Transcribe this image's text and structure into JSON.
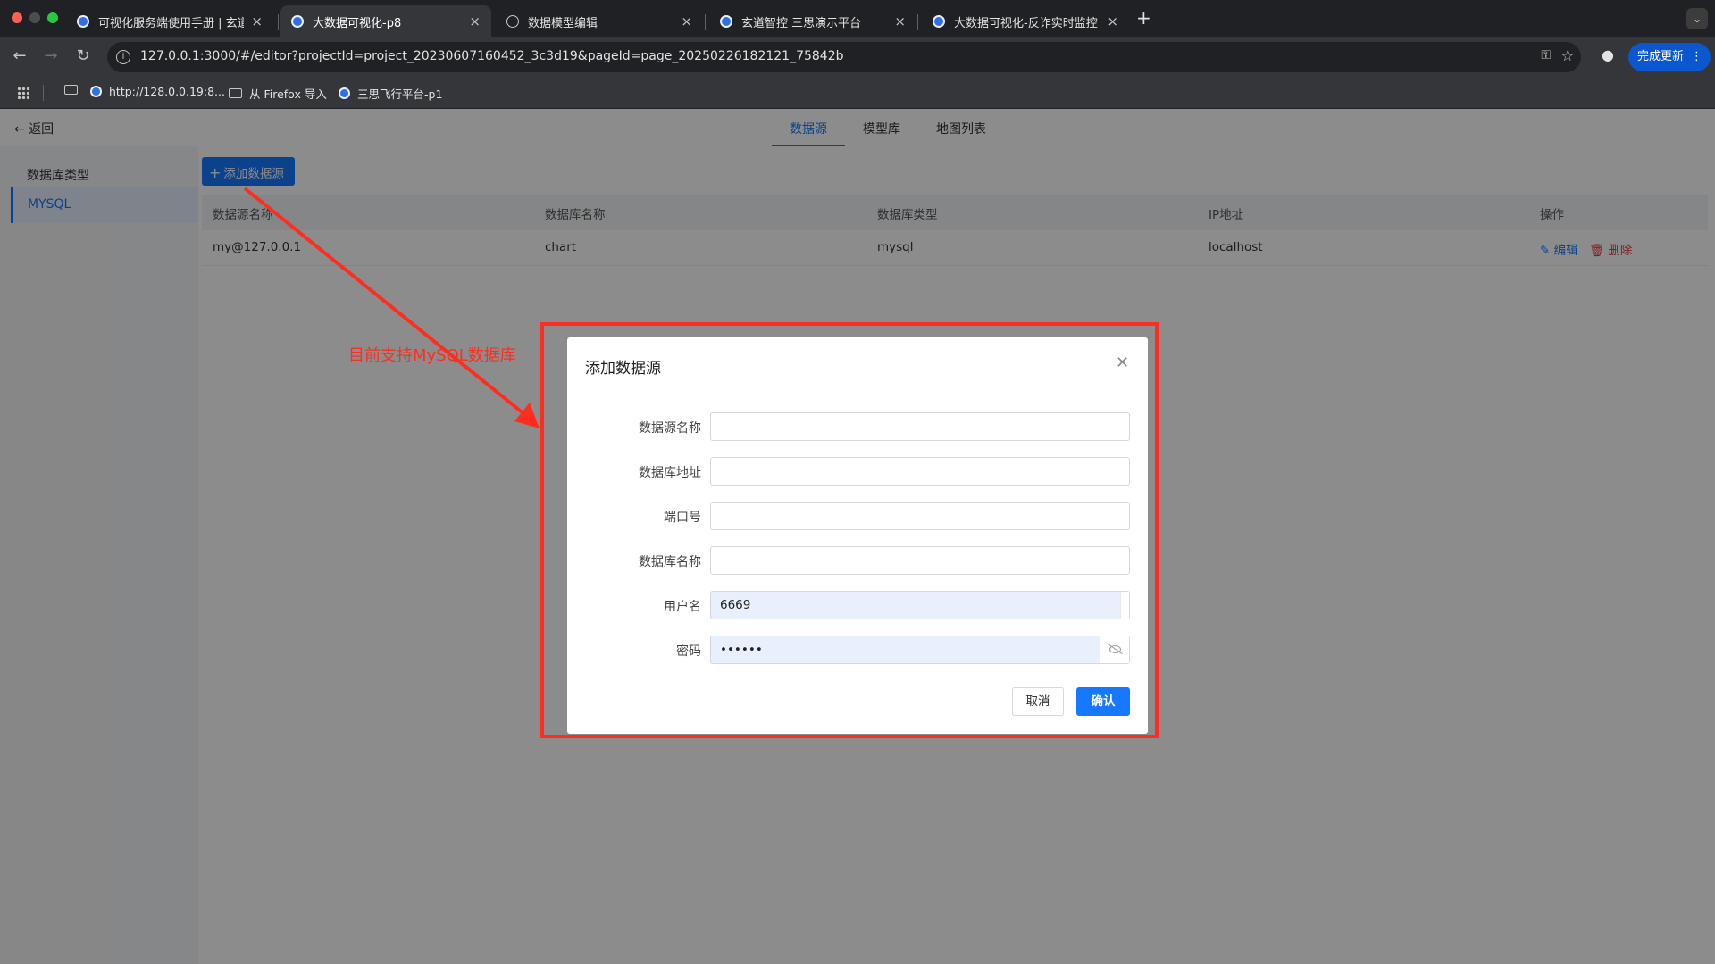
{
  "browser": {
    "tabs": [
      {
        "title": "可视化服务端使用手册 | 玄道智",
        "active": false
      },
      {
        "title": "大数据可视化-p8",
        "active": true
      },
      {
        "title": "数据模型编辑",
        "active": false
      },
      {
        "title": "玄道智控 三思演示平台",
        "active": false
      },
      {
        "title": "大数据可视化-反诈实时监控",
        "active": false
      }
    ],
    "tab_close_glyph": "×",
    "new_tab_glyph": "+",
    "tab_menu_glyph": "⌄",
    "url": "127.0.0.1:3000/#/editor?projectId=project_20230607160452_3c3d19&pageId=page_20250226182121_75842b",
    "update_button": "完成更新",
    "bookmarks": [
      {
        "label": "http://128.0.0.19:8..."
      },
      {
        "label": "从 Firefox 导入"
      },
      {
        "label": "三思飞行平台-p1"
      }
    ],
    "colors": {
      "traffic_red": "#ff5f57",
      "traffic_yellow": "#febc2e",
      "traffic_green": "#28c840",
      "update_button_bg": "#0b57d0"
    }
  },
  "page": {
    "back_label": "返回",
    "tabs": [
      "数据源",
      "模型库",
      "地图列表"
    ],
    "active_tab": "数据源",
    "sidebar": {
      "title": "数据库类型",
      "items": [
        "MYSQL"
      ]
    },
    "add_button": "添加数据源",
    "table": {
      "headers": [
        "数据源名称",
        "数据库名称",
        "数据库类型",
        "IP地址",
        "操作"
      ],
      "rows": [
        {
          "name": "my@127.0.0.1",
          "db_name": "chart",
          "db_type": "mysql",
          "ip": "localhost",
          "edit": "编辑",
          "delete": "删除"
        }
      ]
    },
    "accent_color": "#1677ff"
  },
  "annotation": {
    "text": "目前支持MySQL数据库",
    "color": "#ff2d20"
  },
  "modal": {
    "title": "添加数据源",
    "fields": [
      {
        "label": "数据源名称",
        "value": ""
      },
      {
        "label": "数据库地址",
        "value": ""
      },
      {
        "label": "端口号",
        "value": ""
      },
      {
        "label": "数据库名称",
        "value": ""
      },
      {
        "label": "用户名",
        "value": "6669"
      },
      {
        "label": "密码",
        "value": "••••••"
      }
    ],
    "cancel": "取消",
    "confirm": "确认"
  }
}
